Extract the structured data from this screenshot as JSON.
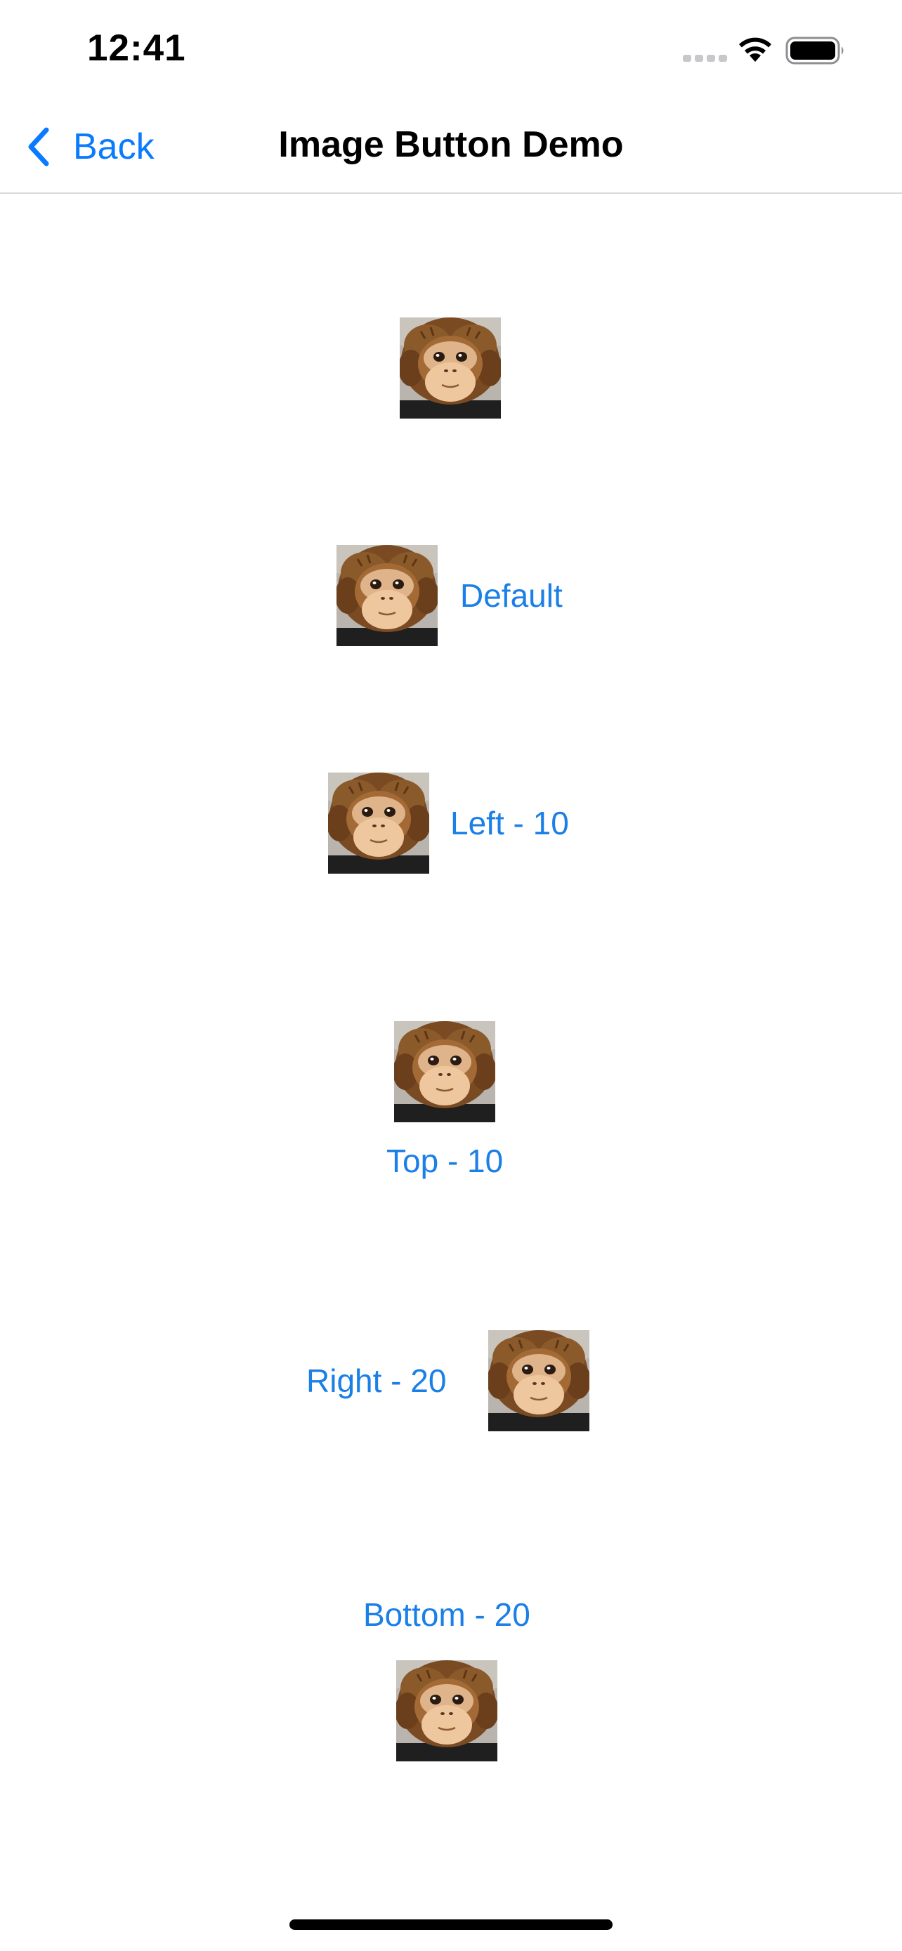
{
  "status_bar": {
    "time": "12:41"
  },
  "nav": {
    "back_label": "Back",
    "title": "Image Button Demo"
  },
  "buttons": [
    {
      "label": "",
      "image": "monkey-photo"
    },
    {
      "label": "Default",
      "image": "monkey-photo"
    },
    {
      "label": "Left - 10",
      "image": "monkey-photo"
    },
    {
      "label": "Top - 10",
      "image": "monkey-photo"
    },
    {
      "label": "Right - 20",
      "image": "monkey-photo"
    },
    {
      "label": "Bottom - 20",
      "image": "monkey-photo"
    }
  ],
  "colors": {
    "accent": "#0a7aff",
    "button_text": "#1a7fe6"
  }
}
